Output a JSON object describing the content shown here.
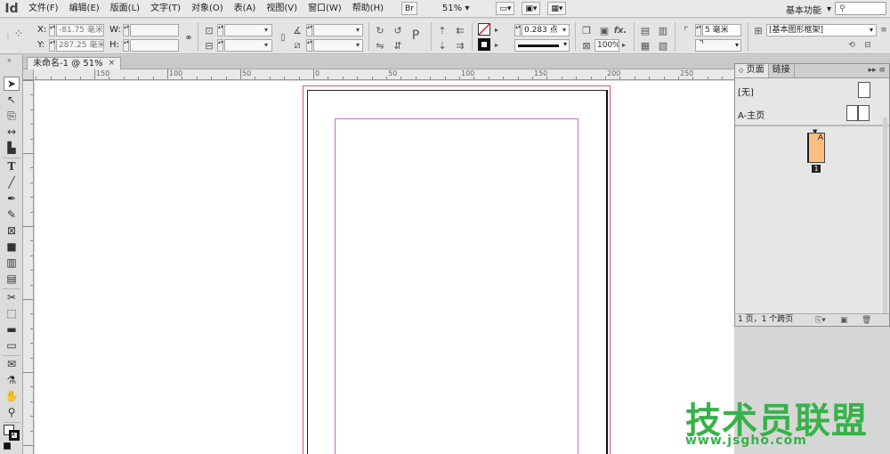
{
  "app": {
    "logo": "Id"
  },
  "menubar": {
    "items": [
      "文件(F)",
      "编辑(E)",
      "版面(L)",
      "文字(T)",
      "对象(O)",
      "表(A)",
      "视图(V)",
      "窗口(W)",
      "帮助(H)"
    ],
    "bridge_label": "Br",
    "zoom": "51%",
    "workspace": "基本功能",
    "search_placeholder": ""
  },
  "controlbar": {
    "x_label": "X:",
    "x_value": "-81.75 毫米",
    "y_label": "Y:",
    "y_value": "287.25 毫米",
    "w_label": "W:",
    "h_label": "H:",
    "stroke_weight": "0.283 点",
    "opacity": "100%",
    "corner_size": "5 毫米",
    "object_style": "[基本图形框架]"
  },
  "document": {
    "tab_title": "未命名-1 @ 51%",
    "tab_close": "×"
  },
  "ruler": {
    "top_labels": [
      "150",
      "100",
      "50",
      "0",
      "50",
      "100",
      "150",
      "200",
      "250"
    ]
  },
  "pages_panel": {
    "tab_pages": "页面",
    "tab_links": "链接",
    "master_none": "[无]",
    "master_a": "A-主页",
    "page_letter": "A",
    "page_number": "1",
    "footer": "1 页，1 个跨页"
  },
  "watermark": {
    "title": "技术员联盟",
    "url": "www.jsgho.com"
  },
  "colors": {
    "bleed": "#e0506a",
    "margin": "#c070d8",
    "page_thumb": "#fbbf84",
    "watermark": "#37b24a"
  }
}
